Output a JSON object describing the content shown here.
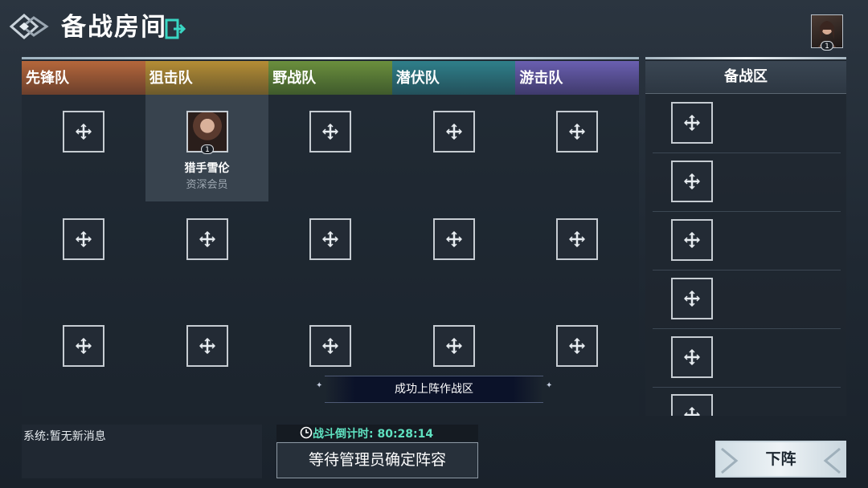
{
  "header": {
    "title": "备战房间",
    "avatar_badge": "1"
  },
  "squads": {
    "tabs": [
      {
        "label": "先锋队"
      },
      {
        "label": "狙击队"
      },
      {
        "label": "野战队"
      },
      {
        "label": "潜伏队"
      },
      {
        "label": "游击队"
      }
    ],
    "member": {
      "name": "猎手雪伦",
      "rank": "资深会员",
      "badge": "1"
    }
  },
  "bench": {
    "title": "备战区"
  },
  "toast": "成功上阵作战区",
  "system_message": "系统:暂无新消息",
  "timer": {
    "label": "战斗倒计时: 80:28:14"
  },
  "wait_button": "等待管理员确定阵容",
  "remove_button": "下阵",
  "colors": {
    "timer_text": "#5fe1c0",
    "tab_vanguard": "#b5673b",
    "tab_sniper": "#b58d35",
    "tab_field": "#6b8f3d",
    "tab_ambush": "#2f7f8a",
    "tab_guerrilla": "#6a5fb0"
  }
}
